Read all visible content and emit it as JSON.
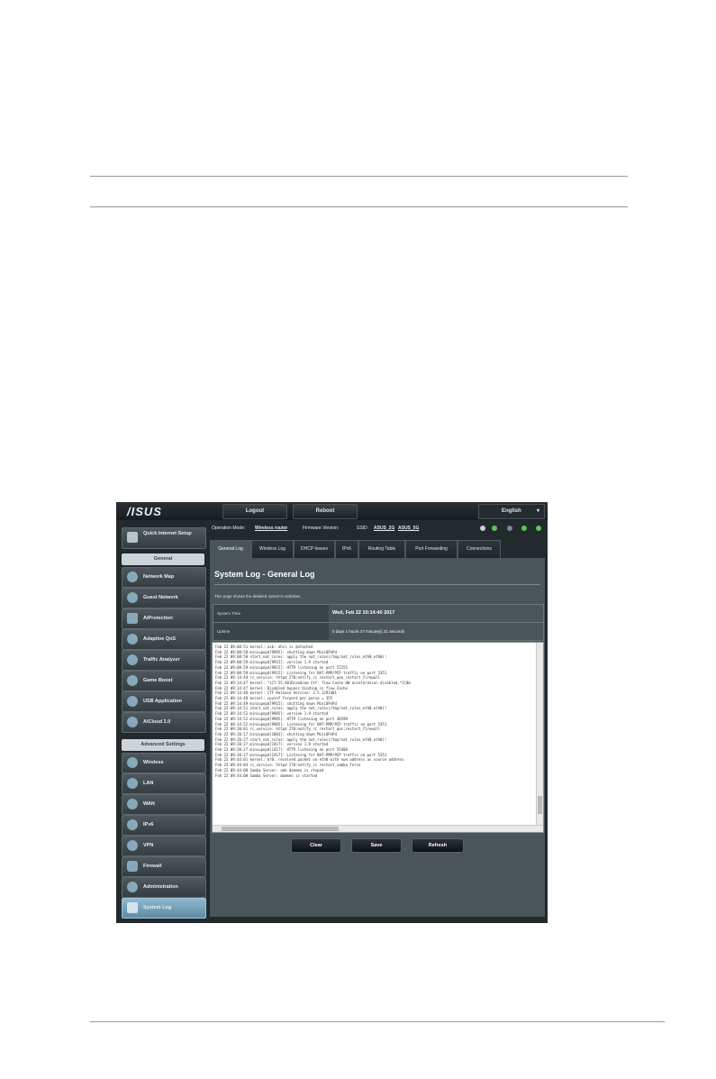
{
  "router": {
    "logo": "/ISUS",
    "topbar": {
      "logout": "Logout",
      "reboot": "Reboot",
      "language": "English"
    },
    "sidebar": {
      "quick_setup": "Quick Internet Setup",
      "general_header": "General",
      "general_items": [
        "Network Map",
        "Guest Network",
        "AiProtection",
        "Adaptive QoS",
        "Traffic Analyzer",
        "Game Boost",
        "USB Application",
        "AiCloud 2.0"
      ],
      "advanced_header": "Advanced Settings",
      "advanced_items": [
        "Wireless",
        "LAN",
        "WAN",
        "IPv6",
        "VPN",
        "Firewall",
        "Administration",
        "System Log"
      ]
    },
    "operation": {
      "mode_label": "Operation Mode:",
      "mode_value": "Wireless router",
      "firmware_label": "Firmware Version:",
      "ssid_label": "SSID:",
      "ssid_1": "ASUS_2G",
      "ssid_2": "ASUS_5G"
    },
    "tabs": [
      "General Log",
      "Wireless Log",
      "DHCP leases",
      "IPv6",
      "Routing Table",
      "Port Forwarding",
      "Connections"
    ],
    "panel": {
      "title": "System Log - General Log",
      "description": "This page shows the detailed system's activities.",
      "system_time_label": "System Time",
      "system_time_value": "Wed, Feb 22 10:14:40 2017",
      "uptime_label": "Uptime",
      "uptime_value": "0 days 1 hours 17 minute(s) 21 seconds"
    },
    "log_lines": [
      "Feb 22 09:08:51 kernel: usb: ehci is detached",
      "Feb 22 09:08:58 miniupnpd[9995]: shutting down MiniUPnPd",
      "Feb 22 09:08:58 start_nat_rules: apply the nat_rules(/tmp/nat_rules_eth0_eth0)!",
      "Feb 22 09:08:59 miniupnpd[9915]: version 1.9 started",
      "Feb 22 09:08:59 miniupnpd[9915]: HTTP listening on port 57255",
      "Feb 22 09:08:59 miniupnpd[9915]: Listening for NAT-PMP/PCP traffic on port 5351",
      "Feb 22 09:14:44 rc_service: httpd 278:notify_rc restart_wan_restart_firewall",
      "Feb 22 09:14:47 kernel: *1[5:55:40]Broadcom Ctf: flow Cache HW acceleration disabled,*1[0m",
      "Feb 22 09:14:47 kernel: Disabled bypass binding in flow Cache",
      "Feb 22 09:14:48 kernel: CTF Release Version: 3.5.1291401",
      "Feb 22 09:14:48 kernel: cpuinf forward per parse = 355",
      "Feb 22 09:14:49 miniupnpd[9915]: shutting down MiniUPnPd",
      "Feb 22 09:14:51 start_nat_rules: apply the nat_rules(/tmp/nat_rules_eth0_eth0)!",
      "Feb 22 09:14:52 miniupnpd[9985]: version 1.9 started",
      "Feb 22 09:14:52 miniupnpd[9985]: HTTP listening on port 40599",
      "Feb 22 09:14:52 miniupnpd[9985]: Listening for NAT-PMP/PCP traffic on port 5351",
      "Feb 22 09:20:01 rc_service: httpd 278:notify_rc restart_qos;restart_firewall",
      "Feb 22 09:20:17 miniupnpd[1083]: shutting down MiniUPnPd",
      "Feb 22 09:20:27 start_nat_rules: apply the nat_rules(/tmp/nat_rules_eth0_eth0)!",
      "Feb 22 09:20:27 miniupnpd[1417]: version 1.9 started",
      "Feb 22 09:20:27 miniupnpd[1417]: HTTP listening on port 55488",
      "Feb 22 09:20:27 miniupnpd[1417]: Listening for NAT-PMP/PCP traffic on port 5351",
      "Feb 22 09:44:01 kernel: br0: received packet on eth0 with own address as source address",
      "Feb 22 09:44:04 rc_service: httpd 278:notify_rc restart_samba_force",
      "Feb 22 09:44:08 Samba Server: smb daemon is stoped",
      "Feb 22 09:44:08 Samba Server: daemon is started"
    ],
    "buttons": {
      "clear": "Clear",
      "save": "Save",
      "refresh": "Refresh"
    }
  }
}
